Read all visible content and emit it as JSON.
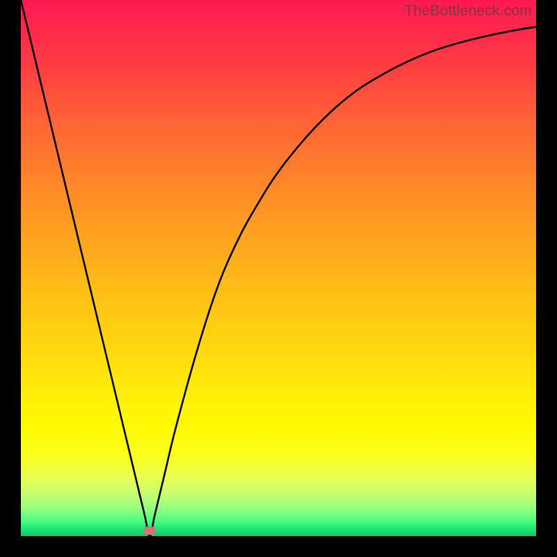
{
  "watermark": "TheBottleneck.com",
  "chart_data": {
    "type": "line",
    "title": "",
    "xlabel": "",
    "ylabel": "",
    "xlim": [
      0,
      100
    ],
    "ylim": [
      0,
      100
    ],
    "series": [
      {
        "name": "curve",
        "x": [
          0,
          5,
          10,
          15,
          20,
          22,
          24,
          25,
          26,
          28,
          30,
          34,
          38,
          42,
          46,
          50,
          55,
          60,
          65,
          70,
          75,
          80,
          85,
          90,
          95,
          100
        ],
        "values": [
          100,
          80,
          60,
          40,
          20,
          12,
          4,
          0,
          4,
          12,
          20,
          34,
          46,
          55,
          62,
          68,
          74,
          79,
          83,
          86,
          88.5,
          90.5,
          92,
          93.2,
          94.2,
          95
        ]
      }
    ],
    "marker": {
      "x": 25,
      "y": 1
    },
    "colors": {
      "curve": "#000000",
      "marker": "#d07878",
      "gradient_top": "#ff1a51",
      "gradient_bottom": "#16c268"
    }
  }
}
